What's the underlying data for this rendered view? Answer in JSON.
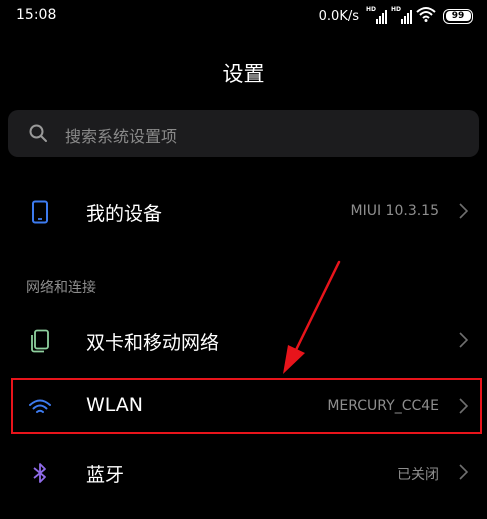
{
  "status_bar": {
    "time": "15:08",
    "net_speed": "0.0K/s",
    "signal_tag": "HD",
    "battery": "99"
  },
  "header": {
    "title": "设置"
  },
  "search": {
    "placeholder": "搜索系统设置项"
  },
  "my_device": {
    "label": "我的设备",
    "value": "MIUI 10.3.15",
    "icon": "phone-icon"
  },
  "network_section": {
    "title": "网络和连接",
    "items": [
      {
        "label": "双卡和移动网络",
        "value": "",
        "icon": "sim-card-icon"
      },
      {
        "label": "WLAN",
        "value": "MERCURY_CC4E",
        "icon": "wifi-icon"
      },
      {
        "label": "蓝牙",
        "value": "已关闭",
        "icon": "bluetooth-icon"
      }
    ]
  },
  "colors": {
    "background": "#000000",
    "search_bg": "#1c1c1e",
    "accent_blue": "#3d7bf0",
    "sim_green": "#8fd19e",
    "bluetooth_purple": "#8f6be8",
    "annotation_red": "#e8141b",
    "secondary_text": "#8e8e8e"
  }
}
